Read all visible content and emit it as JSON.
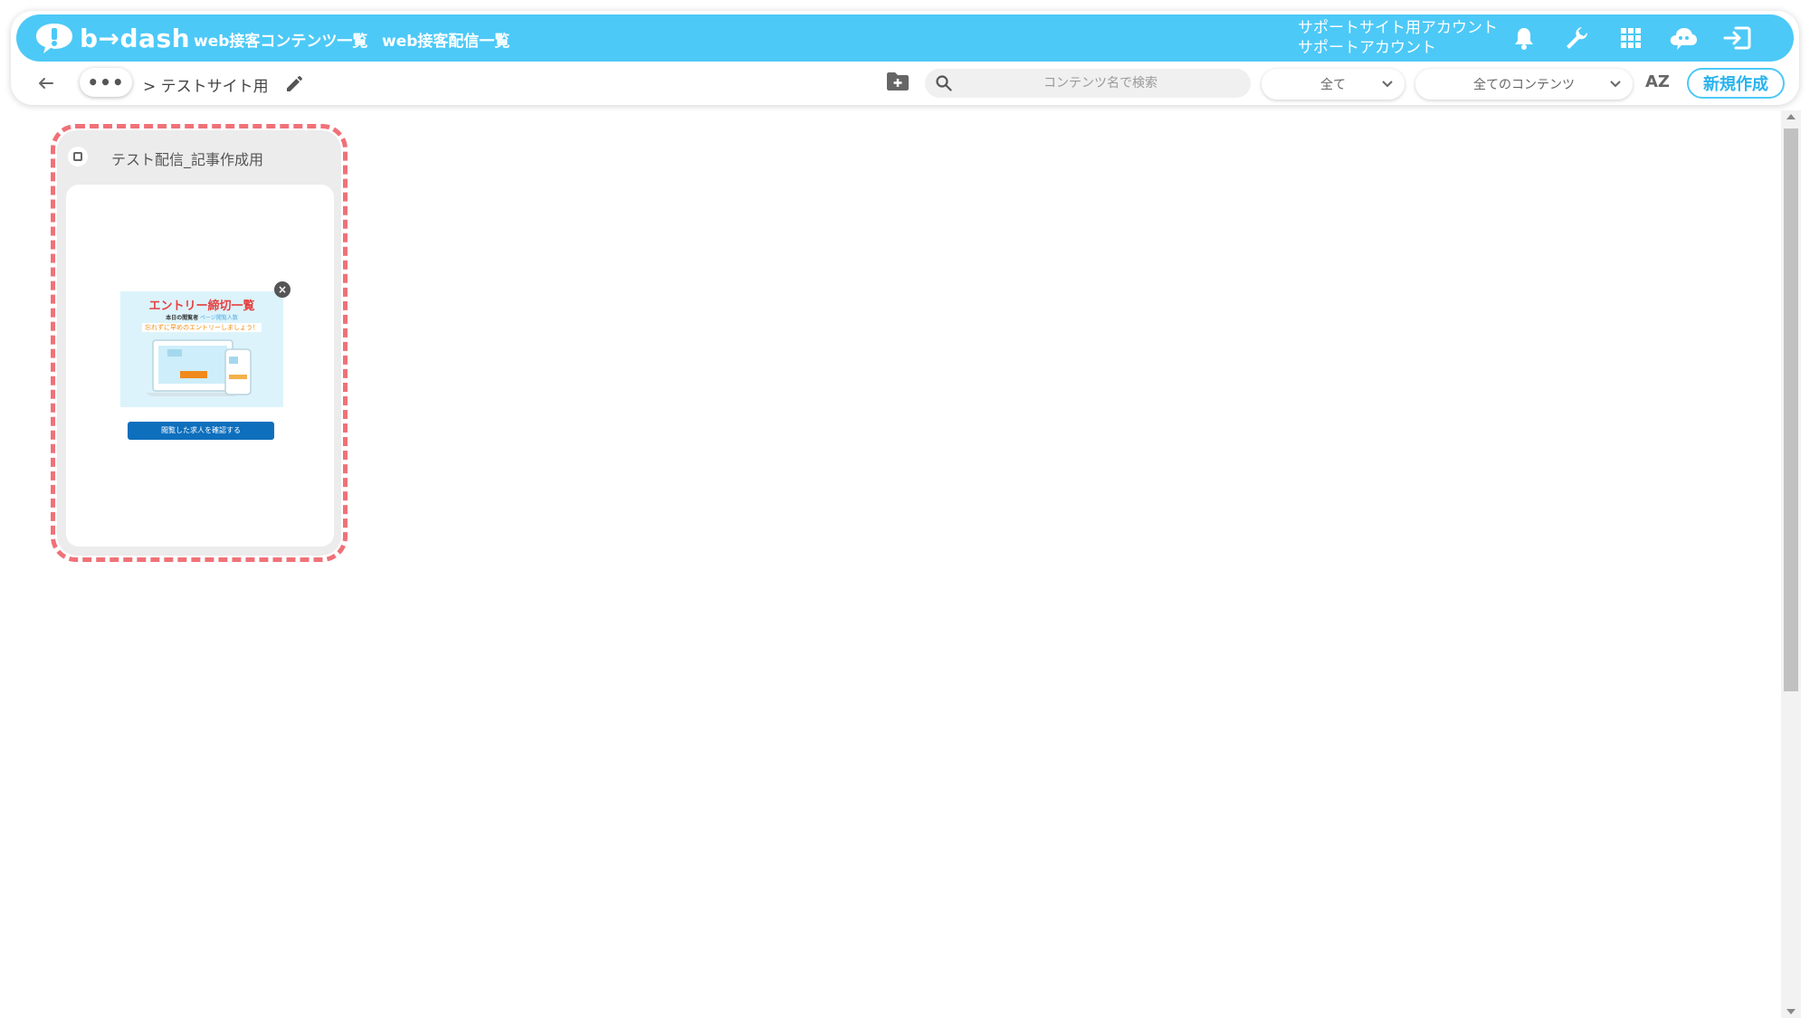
{
  "header": {
    "brand": "b→dash",
    "nav": [
      {
        "label": "web接客コンテンツ一覧"
      },
      {
        "label": "web接客配信一覧"
      }
    ],
    "account_line1": "サポートサイト用アカウント",
    "account_line2": "サポートアカウント",
    "icons": [
      "bell-icon",
      "wrench-icon",
      "apps-grid-icon",
      "cloud-chat-icon",
      "logout-icon"
    ]
  },
  "toolbar": {
    "more_label": "•••",
    "breadcrumb": "> テストサイト用",
    "search_placeholder": "コンテンツ名で検索",
    "filter_status": "全て",
    "filter_content": "全てのコンテンツ",
    "sort_label": "AZ",
    "new_button": "新規作成"
  },
  "cards": [
    {
      "title": "テスト配信_記事作成用",
      "preview": {
        "headline": "エントリー締切一覧",
        "line1_a": "本日の閲覧者",
        "line1_b": "ページ閲覧人数",
        "line2": "忘れずに早めのエントリーしましょう！",
        "button_label": "閲覧した求人を確認する"
      }
    }
  ],
  "colors": {
    "brand": "#4cc9f7",
    "highlight": "#f07178",
    "preview_button": "#0e6fbd"
  }
}
